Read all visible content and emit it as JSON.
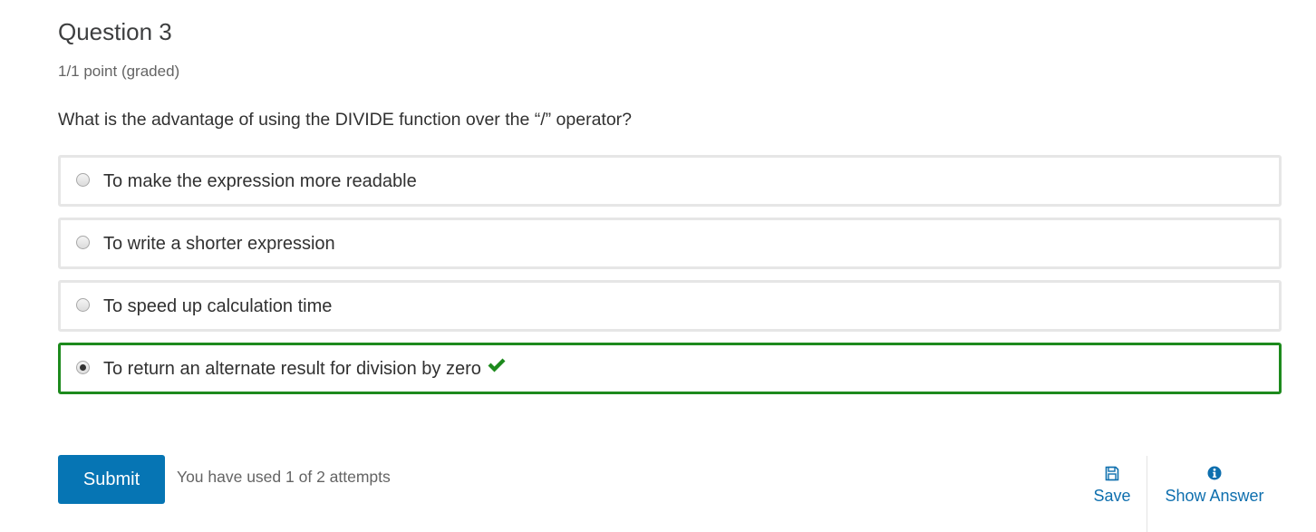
{
  "question": {
    "title": "Question 3",
    "points": "1/1 point (graded)",
    "prompt": "What is the advantage of using the DIVIDE function over the “/” operator?"
  },
  "choices": [
    {
      "label": "To make the expression more readable",
      "selected": false,
      "status": "none"
    },
    {
      "label": "To write a shorter expression",
      "selected": false,
      "status": "none"
    },
    {
      "label": "To speed up calculation time",
      "selected": false,
      "status": "none"
    },
    {
      "label": "To return an alternate result for division by zero",
      "selected": true,
      "status": "correct",
      "status_icon": "checkmark-icon"
    }
  ],
  "actions": {
    "submit_label": "Submit",
    "attempts_text": "You have used 1 of 2 attempts",
    "save_label": "Save",
    "save_icon": "save-icon",
    "show_answer_label": "Show Answer",
    "show_answer_icon": "info-icon"
  },
  "colors": {
    "accent": "#0675b4",
    "correct": "#1d8a1d",
    "link": "#0e6fae"
  }
}
